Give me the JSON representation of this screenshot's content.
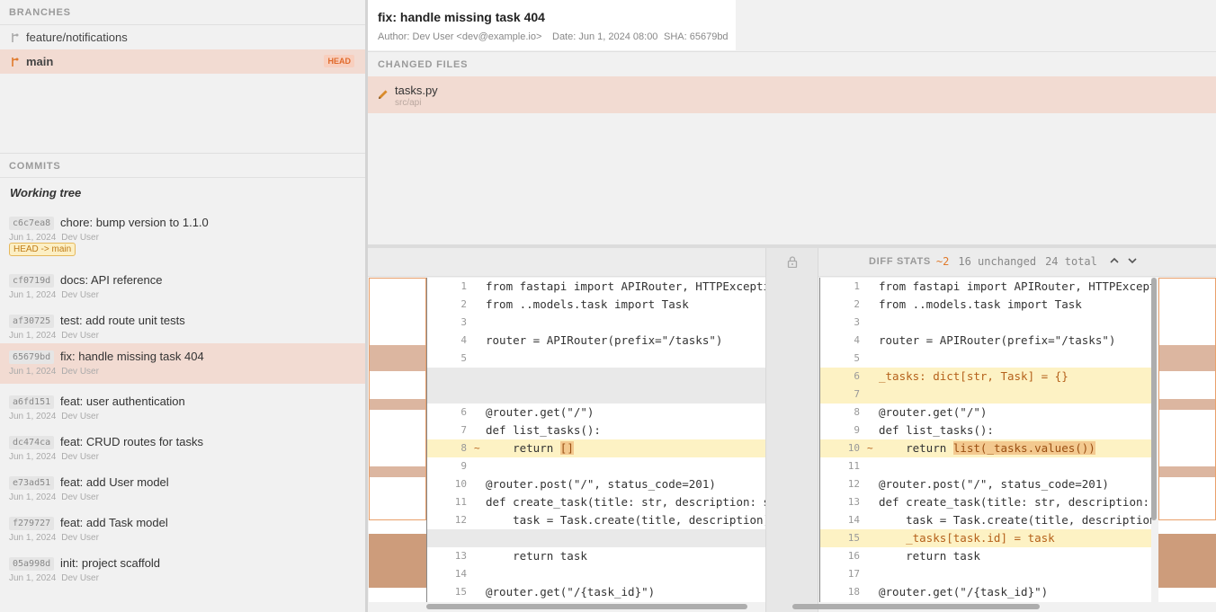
{
  "branches": {
    "heading": "BRANCHES",
    "items": [
      {
        "name": "feature/notifications",
        "selected": false
      },
      {
        "name": "main",
        "selected": true,
        "badge": "HEAD"
      }
    ]
  },
  "commits": {
    "heading": "COMMITS",
    "working_tree": "Working tree",
    "items": [
      {
        "sha": "c6c7ea8",
        "message": "chore: bump version to 1.1.0",
        "date": "Jun 1, 2024",
        "author": "Dev User",
        "ref": "HEAD -> main"
      },
      {
        "sha": "cf0719d",
        "message": "docs: API reference",
        "date": "Jun 1, 2024",
        "author": "Dev User"
      },
      {
        "sha": "af30725",
        "message": "test: add route unit tests",
        "date": "Jun 1, 2024",
        "author": "Dev User"
      },
      {
        "sha": "65679bd",
        "message": "fix: handle missing task 404",
        "date": "Jun 1, 2024",
        "author": "Dev User",
        "selected": true
      },
      {
        "sha": "a6fd151",
        "message": "feat: user authentication",
        "date": "Jun 1, 2024",
        "author": "Dev User"
      },
      {
        "sha": "dc474ca",
        "message": "feat: CRUD routes for tasks",
        "date": "Jun 1, 2024",
        "author": "Dev User"
      },
      {
        "sha": "e73ad51",
        "message": "feat: add User model",
        "date": "Jun 1, 2024",
        "author": "Dev User"
      },
      {
        "sha": "f279727",
        "message": "feat: add Task model",
        "date": "Jun 1, 2024",
        "author": "Dev User"
      },
      {
        "sha": "05a998d",
        "message": "init: project scaffold",
        "date": "Jun 1, 2024",
        "author": "Dev User"
      }
    ]
  },
  "commit_detail": {
    "title": "fix: handle missing task 404",
    "author": "Author: Dev User <dev@example.io>",
    "date": "Date: Jun 1, 2024 08:00",
    "sha": "SHA: 65679bd"
  },
  "changed_files": {
    "heading": "CHANGED FILES",
    "items": [
      {
        "name": "tasks.py",
        "path": "src/api",
        "icon": "pencil-icon"
      }
    ]
  },
  "diff_stats": {
    "label": "DIFF STATS",
    "changed": "~2",
    "unchanged": "16 unchanged",
    "total": "24 total"
  },
  "diff": {
    "left": [
      {
        "num": "1",
        "code": "from fastapi import APIRouter, HTTPException"
      },
      {
        "num": "2",
        "code": "from ..models.task import Task"
      },
      {
        "num": "3",
        "code": ""
      },
      {
        "num": "4",
        "code": "router = APIRouter(prefix=\"/tasks\")"
      },
      {
        "num": "5",
        "code": ""
      },
      {
        "type": "filler"
      },
      {
        "type": "filler"
      },
      {
        "num": "6",
        "code": "@router.get(\"/\")"
      },
      {
        "num": "7",
        "code": "def list_tasks():"
      },
      {
        "num": "8",
        "type": "chg",
        "mark": "~",
        "pre": "    return ",
        "hl": "[]",
        "post": ""
      },
      {
        "num": "9",
        "code": ""
      },
      {
        "num": "10",
        "code": "@router.post(\"/\", status_code=201)"
      },
      {
        "num": "11",
        "code": "def create_task(title: str, description: str):"
      },
      {
        "num": "12",
        "code": "    task = Task.create(title, description)"
      },
      {
        "type": "filler"
      },
      {
        "num": "13",
        "code": "    return task"
      },
      {
        "num": "14",
        "code": ""
      },
      {
        "num": "15",
        "code": "@router.get(\"/{task_id}\")"
      }
    ],
    "right": [
      {
        "num": "1",
        "code": "from fastapi import APIRouter, HTTPException"
      },
      {
        "num": "2",
        "code": "from ..models.task import Task"
      },
      {
        "num": "3",
        "code": ""
      },
      {
        "num": "4",
        "code": "router = APIRouter(prefix=\"/tasks\")"
      },
      {
        "num": "5",
        "code": ""
      },
      {
        "num": "6",
        "type": "add",
        "code": "_tasks: dict[str, Task] = {}"
      },
      {
        "num": "7",
        "type": "add",
        "code": ""
      },
      {
        "num": "8",
        "code": "@router.get(\"/\")"
      },
      {
        "num": "9",
        "code": "def list_tasks():"
      },
      {
        "num": "10",
        "type": "chg",
        "mark": "~",
        "pre": "    return ",
        "hl": "list(_tasks.values())",
        "post": ""
      },
      {
        "num": "11",
        "code": ""
      },
      {
        "num": "12",
        "code": "@router.post(\"/\", status_code=201)"
      },
      {
        "num": "13",
        "code": "def create_task(title: str, description: str):"
      },
      {
        "num": "14",
        "code": "    task = Task.create(title, description)"
      },
      {
        "num": "15",
        "type": "add",
        "code": "    _tasks[task.id] = task"
      },
      {
        "num": "16",
        "code": "    return task"
      },
      {
        "num": "17",
        "code": ""
      },
      {
        "num": "18",
        "code": "@router.get(\"/{task_id}\")"
      }
    ]
  }
}
